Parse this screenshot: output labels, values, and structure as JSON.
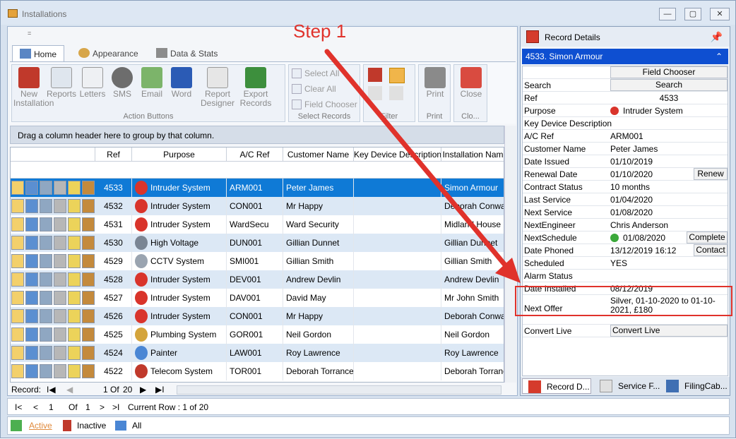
{
  "window": {
    "title": "Installations",
    "min": "—",
    "max": "▢",
    "close": "✕"
  },
  "qat": "=",
  "tabs": [
    {
      "label": "Home",
      "active": true
    },
    {
      "label": "Appearance",
      "active": false
    },
    {
      "label": "Data & Stats",
      "active": false
    }
  ],
  "ribbon": {
    "action_buttons": [
      "New Installation",
      "Reports",
      "Letters",
      "SMS",
      "Email",
      "Word",
      "Report Designer",
      "Export Records"
    ],
    "action_group_label": "Action Buttons",
    "select_records": {
      "select_all": "Select All",
      "clear_all": "Clear All",
      "field_chooser": "Field Chooser",
      "label": "Select Records"
    },
    "filter_label": "Filter",
    "print": {
      "button": "Print",
      "label": "Print"
    },
    "close": {
      "button": "Close",
      "label": "Clo..."
    }
  },
  "grid": {
    "group_hint": "Drag a column header here to group by that column.",
    "columns": [
      "Ref",
      "Purpose",
      "A/C Ref",
      "Customer Name",
      "Key Device Description",
      "Installation Nam"
    ],
    "rows": [
      {
        "ref": "4533",
        "purpose": "Intruder System",
        "ac": "ARM001",
        "customer": "Peter James",
        "key": "",
        "inst": "Simon Armour",
        "icon": "alarm-bell-icon",
        "selected": true
      },
      {
        "ref": "4532",
        "purpose": "Intruder System",
        "ac": "CON001",
        "customer": "Mr Happy",
        "key": "",
        "inst": "Deborah Conway",
        "icon": "alarm-bell-icon"
      },
      {
        "ref": "4531",
        "purpose": "Intruder System",
        "ac": "WardSecu",
        "customer": "Ward Security",
        "key": "",
        "inst": "Midland House",
        "icon": "alarm-bell-icon"
      },
      {
        "ref": "4530",
        "purpose": "High Voltage",
        "ac": "DUN001",
        "customer": "Gillian Dunnet",
        "key": "",
        "inst": "Gillian Dunnet",
        "icon": "high-voltage-icon"
      },
      {
        "ref": "4529",
        "purpose": "CCTV System",
        "ac": "SMI001",
        "customer": "Gillian Smith",
        "key": "",
        "inst": "Gillian Smith",
        "icon": "cctv-camera-icon"
      },
      {
        "ref": "4528",
        "purpose": "Intruder System",
        "ac": "DEV001",
        "customer": "Andrew Devlin",
        "key": "",
        "inst": "Andrew Devlin",
        "icon": "alarm-bell-icon"
      },
      {
        "ref": "4527",
        "purpose": "Intruder System",
        "ac": "DAV001",
        "customer": "David May",
        "key": "",
        "inst": "Mr John Smith",
        "icon": "alarm-bell-icon"
      },
      {
        "ref": "4526",
        "purpose": "Intruder System",
        "ac": "CON001",
        "customer": "Mr Happy",
        "key": "",
        "inst": "Deborah Conway",
        "icon": "alarm-bell-icon"
      },
      {
        "ref": "4525",
        "purpose": "Plumbing System",
        "ac": "GOR001",
        "customer": "Neil Gordon",
        "key": "",
        "inst": "Neil Gordon",
        "icon": "plumber-icon"
      },
      {
        "ref": "4524",
        "purpose": "Painter",
        "ac": "LAW001",
        "customer": "Roy Lawrence",
        "key": "",
        "inst": "Roy Lawrence",
        "icon": "paint-can-icon"
      },
      {
        "ref": "4522",
        "purpose": "Telecom System",
        "ac": "TOR001",
        "customer": "Deborah Torrance",
        "key": "",
        "inst": "Deborah Torrance",
        "icon": "phone-box-icon"
      }
    ],
    "record_nav": {
      "label": "Record:",
      "current": "1",
      "of": "Of",
      "total": "20"
    }
  },
  "status": {
    "first": "I<",
    "prev": "<",
    "page": "1",
    "of": "Of",
    "total": "1",
    "next": ">",
    "last": ">I",
    "current_row": "Current Row : 1 of 20"
  },
  "footer_tabs": [
    "Active",
    "Inactive",
    "All"
  ],
  "side": {
    "title": "Record Details",
    "record": "4533. Simon Armour",
    "field_chooser": "Field Chooser",
    "props": [
      {
        "label": "Search",
        "value": "Search",
        "kind": "button"
      },
      {
        "label": "Ref",
        "value": "4533",
        "kind": "center"
      },
      {
        "label": "Purpose",
        "value": "Intruder System",
        "kind": "icon"
      },
      {
        "label": "Key Device Description",
        "value": ""
      },
      {
        "label": "A/C Ref",
        "value": "ARM001"
      },
      {
        "label": "Customer Name",
        "value": "Peter James"
      },
      {
        "label": "Date Issued",
        "value": "01/10/2019"
      },
      {
        "label": "Renewal Date",
        "value": "01/10/2020",
        "button": "Renew"
      },
      {
        "label": "Contract Status",
        "value": " 10 months"
      },
      {
        "label": "Last Service",
        "value": "01/04/2020"
      },
      {
        "label": "Next Service",
        "value": "01/08/2020"
      },
      {
        "label": "NextEngineer",
        "value": "Chris Anderson"
      },
      {
        "label": "NextSchedule",
        "value": "01/08/2020",
        "button": "Complete",
        "flag": true
      },
      {
        "label": "Date Phoned",
        "value": "13/12/2019 16:12",
        "button": "Contact"
      },
      {
        "label": "Scheduled",
        "value": "YES"
      },
      {
        "label": "Alarm Status",
        "value": ""
      },
      {
        "label": "Date Installed",
        "value": "08/12/2019"
      }
    ],
    "next_offer": {
      "label": "Next Offer",
      "value": "Silver, 01-10-2020 to 01-10-2021, £180"
    },
    "convert": {
      "label": "Convert Live",
      "value": "Convert Live"
    },
    "tabs": [
      "Record D...",
      "Service F...",
      "FilingCab..."
    ]
  },
  "annotation": {
    "step": "Step 1",
    "color": "#e0322b"
  }
}
